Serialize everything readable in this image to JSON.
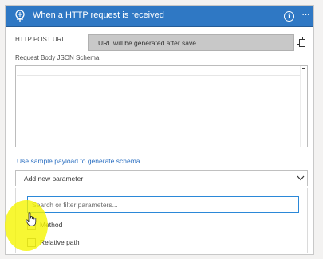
{
  "header": {
    "title": "When a HTTP request is received",
    "trigger_icon": "http-request-trigger-icon",
    "info_icon": "info-icon",
    "info_glyph": "i",
    "more_icon": "ellipsis-icon",
    "more_glyph": "···",
    "background_color": "#2f78c4"
  },
  "http_post_url": {
    "label": "HTTP POST URL",
    "value": "URL will be generated after save",
    "copy_icon": "copy-icon"
  },
  "request_body": {
    "label": "Request Body JSON Schema",
    "value": ""
  },
  "sample_payload_link": "Use sample payload to generate schema",
  "add_parameter": {
    "label": "Add new parameter",
    "icon": "chevron-down-icon"
  },
  "parameter_panel": {
    "search_placeholder": "Search or filter parameters...",
    "options": [
      {
        "label": "Method",
        "checked": false
      },
      {
        "label": "Relative path",
        "checked": false
      }
    ]
  },
  "colors": {
    "accent": "#2f78c4",
    "link": "#2b6fc1",
    "highlight": "#f5f500",
    "focus_border": "#2b88d8"
  }
}
